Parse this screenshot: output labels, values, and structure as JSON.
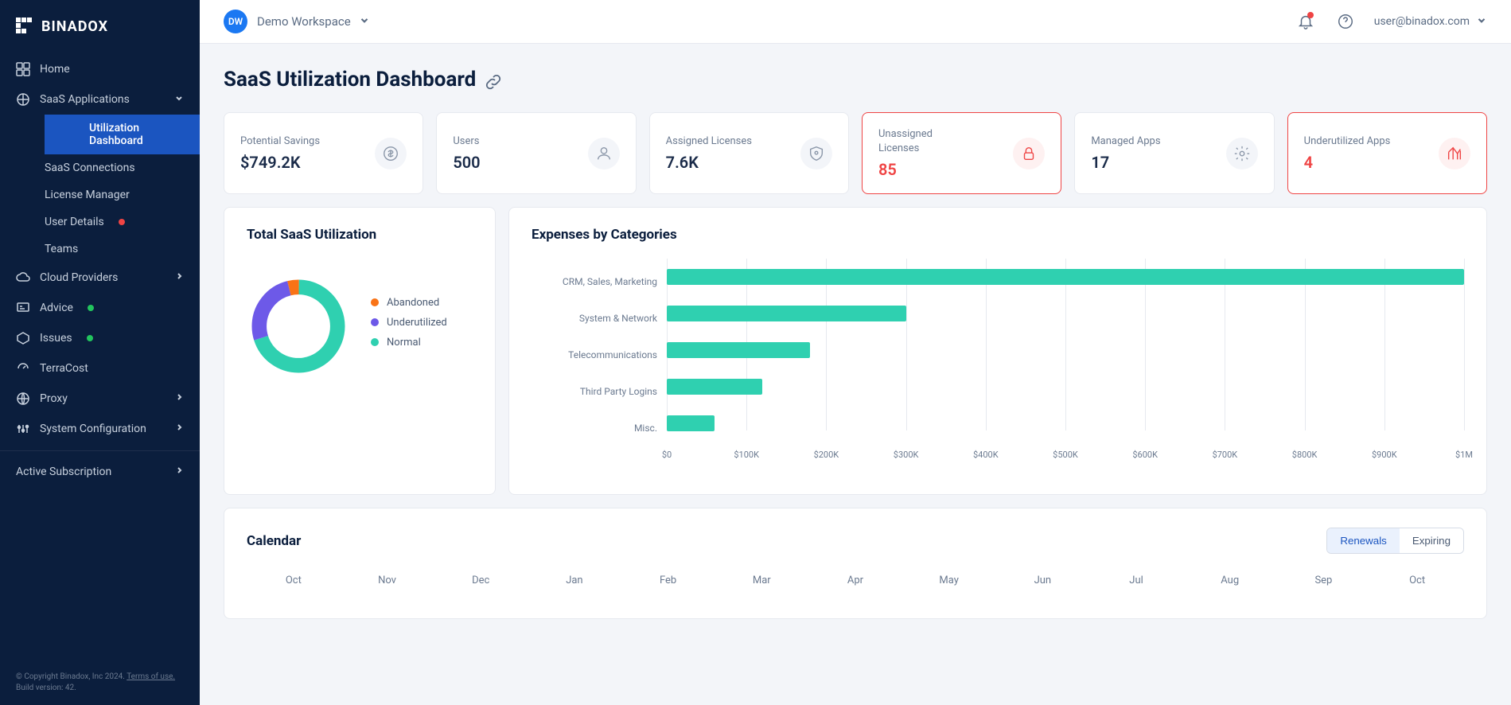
{
  "brand": "BINADOX",
  "workspace": {
    "initials": "DW",
    "name": "Demo Workspace"
  },
  "user": {
    "email": "user@binadox.com"
  },
  "sidebar": {
    "home": "Home",
    "saas": {
      "label": "SaaS Applications",
      "items": [
        "Utilization Dashboard",
        "SaaS Connections",
        "License Manager",
        "User Details",
        "Teams"
      ]
    },
    "cloud": "Cloud Providers",
    "advice": "Advice",
    "issues": "Issues",
    "terracost": "TerraCost",
    "proxy": "Proxy",
    "sysconf": "System Configuration",
    "subscription": "Active Subscription"
  },
  "footer": {
    "copyright": "© Copyright Binadox, Inc 2024.",
    "terms": "Terms of use.",
    "build": "Build version: 42."
  },
  "page_title": "SaaS Utilization Dashboard",
  "kpis": [
    {
      "label": "Potential Savings",
      "value": "$749.2K"
    },
    {
      "label": "Users",
      "value": "500"
    },
    {
      "label": "Assigned Licenses",
      "value": "7.6K"
    },
    {
      "label": "Unassigned Licenses",
      "value": "85",
      "alert": true
    },
    {
      "label": "Managed Apps",
      "value": "17"
    },
    {
      "label": "Underutilized Apps",
      "value": "4",
      "alert": true
    }
  ],
  "donut": {
    "title": "Total SaaS Utilization",
    "legend": [
      "Abandoned",
      "Underutilized",
      "Normal"
    ],
    "colors": [
      "#f97316",
      "#6d59e8",
      "#2fd0b0"
    ]
  },
  "expenses": {
    "title": "Expenses by Categories",
    "ticks": [
      "$0",
      "$100K",
      "$200K",
      "$300K",
      "$400K",
      "$500K",
      "$600K",
      "$700K",
      "$800K",
      "$900K",
      "$1M"
    ]
  },
  "calendar": {
    "title": "Calendar",
    "tabs": [
      "Renewals",
      "Expiring"
    ],
    "months": [
      "Oct",
      "Nov",
      "Dec",
      "Jan",
      "Feb",
      "Mar",
      "Apr",
      "May",
      "Jun",
      "Jul",
      "Aug",
      "Sep",
      "Oct"
    ]
  },
  "chart_data": [
    {
      "type": "pie",
      "title": "Total SaaS Utilization",
      "series": [
        {
          "name": "Abandoned",
          "value": 4,
          "color": "#f97316"
        },
        {
          "name": "Underutilized",
          "value": 26,
          "color": "#6d59e8"
        },
        {
          "name": "Normal",
          "value": 70,
          "color": "#2fd0b0"
        }
      ]
    },
    {
      "type": "bar",
      "title": "Expenses by Categories",
      "orientation": "horizontal",
      "xlabel": "",
      "ylabel": "",
      "xlim": [
        0,
        1000000
      ],
      "categories": [
        "CRM, Sales, Marketing",
        "System & Network",
        "Telecommunications",
        "Third Party Logins",
        "Misc."
      ],
      "values": [
        1000000,
        300000,
        180000,
        120000,
        60000
      ],
      "color": "#2fd0b0",
      "x_ticks": [
        0,
        100000,
        200000,
        300000,
        400000,
        500000,
        600000,
        700000,
        800000,
        900000,
        1000000
      ]
    }
  ]
}
